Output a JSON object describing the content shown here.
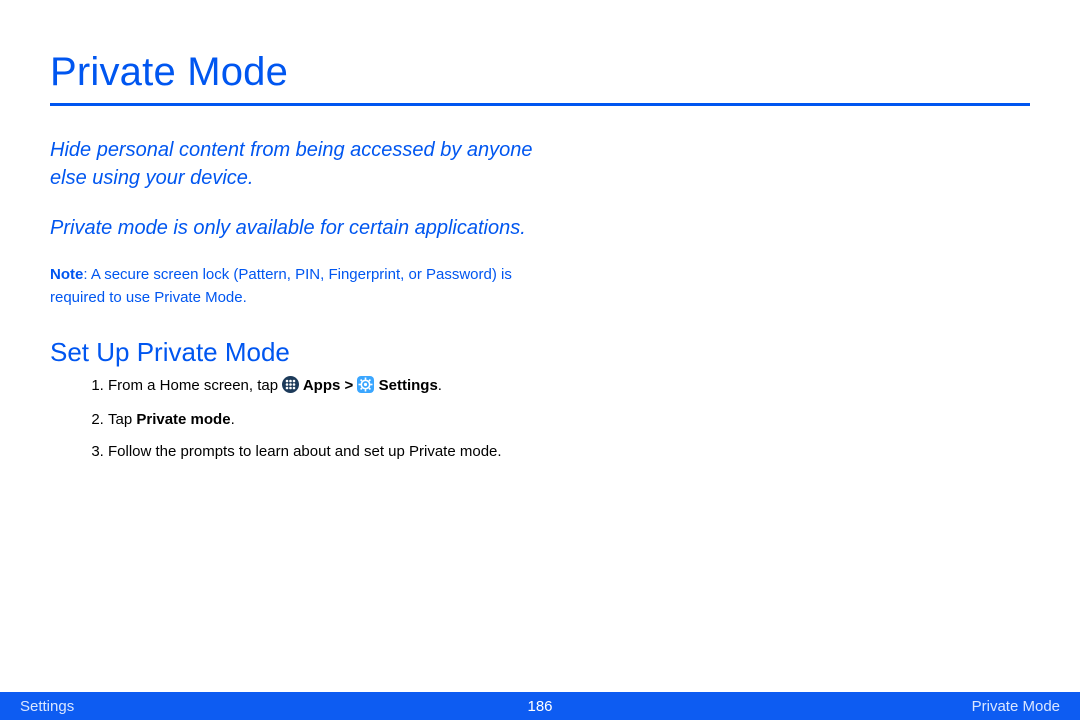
{
  "title": "Private Mode",
  "intro1": "Hide personal content from being accessed by anyone else using your device.",
  "intro2": "Private mode is only available for certain applications.",
  "note_label": "Note",
  "note_text": ": A secure screen lock (Pattern, PIN, Fingerprint, or Password) is required to use Private Mode.",
  "subheading": "Set Up Private Mode",
  "steps": {
    "s1_pre": "From a Home screen, tap ",
    "s1_apps": " Apps > ",
    "s1_settings": " Settings",
    "s1_post": ".",
    "s2_pre": "Tap ",
    "s2_bold": "Private mode",
    "s2_post": ".",
    "s3": "Follow the prompts to learn about and set up Private mode."
  },
  "footer": {
    "left": "Settings",
    "page": "186",
    "right": "Private Mode"
  },
  "icons": {
    "apps": "apps-icon",
    "settings": "settings-icon"
  }
}
